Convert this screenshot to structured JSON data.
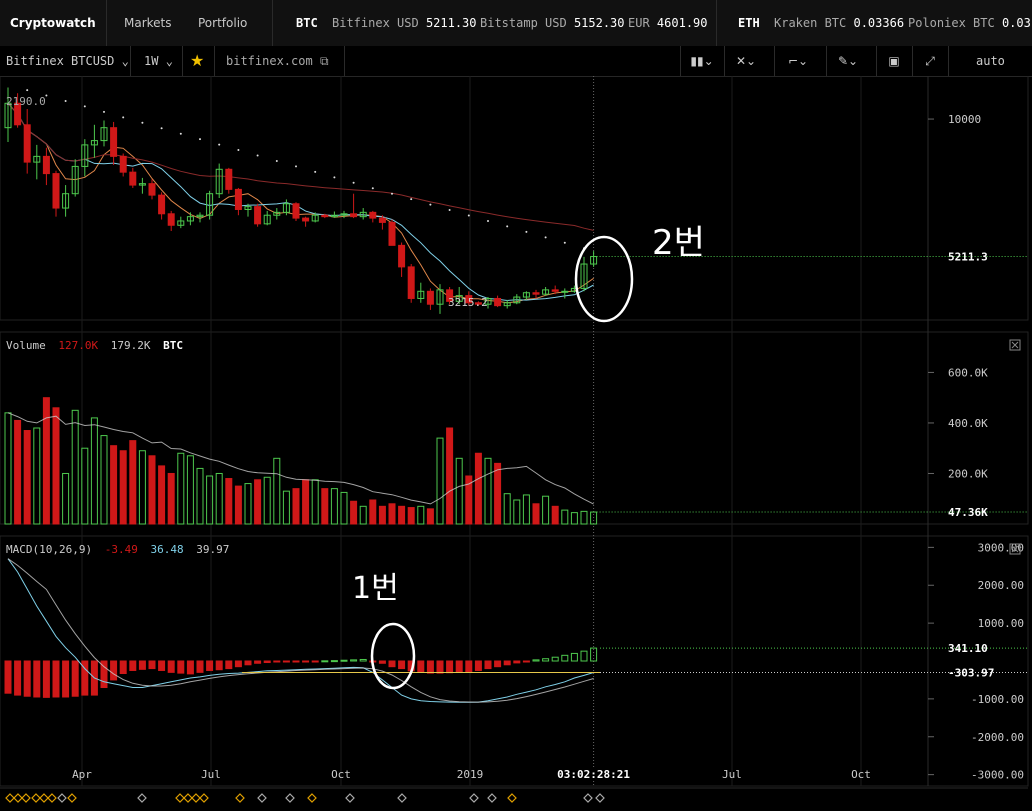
{
  "app": {
    "brand": "Cryptowatch",
    "nav": [
      "Markets",
      "Portfolio"
    ],
    "tickers": [
      {
        "name": "BTC",
        "items": [
          {
            "label": "Bitfinex USD",
            "value": "5211.30"
          },
          {
            "label": "Bitstamp USD",
            "value": "5152.30"
          },
          {
            "label": "EUR",
            "value": "4601.90"
          }
        ]
      },
      {
        "name": "ETH",
        "items": [
          {
            "label": "Kraken BTC",
            "value": "0.03366"
          },
          {
            "label": "Poloniex BTC",
            "value": "0.03..."
          }
        ]
      }
    ]
  },
  "toolbar": {
    "market": "Bitfinex BTCUSD",
    "period": "1W",
    "site": "bitfinex.com",
    "auto": "auto",
    "icons": [
      "chart-type-icon",
      "draw-line-icon",
      "indicator-icon",
      "pencil-icon",
      "panel-icon",
      "fullscreen-icon"
    ]
  },
  "chart_data": [
    {
      "type": "candlestick",
      "title": "Bitfinex BTCUSD 1W",
      "ylim": [
        3000,
        11500
      ],
      "yticks": [
        {
          "value": 10000,
          "label": "10000"
        }
      ],
      "last_price": {
        "value": 5211.3,
        "label": "5211.3"
      },
      "annotations": [
        {
          "text": "2190.0",
          "kind": "top-left label"
        },
        {
          "text": "3215.2",
          "kind": "low marker"
        }
      ],
      "candles": [
        [
          9700,
          11100,
          9200,
          10550
        ],
        [
          10550,
          10900,
          9700,
          9800
        ],
        [
          9800,
          10350,
          8100,
          8500
        ],
        [
          8500,
          9100,
          7900,
          8700
        ],
        [
          8700,
          9000,
          7700,
          8100
        ],
        [
          8100,
          8200,
          6600,
          6900
        ],
        [
          6900,
          7700,
          6600,
          7400
        ],
        [
          7400,
          8600,
          7300,
          8350
        ],
        [
          8350,
          9300,
          8000,
          9100
        ],
        [
          9100,
          9800,
          8650,
          9250
        ],
        [
          9250,
          9950,
          9050,
          9700
        ],
        [
          9700,
          9900,
          8400,
          8700
        ],
        [
          8700,
          8800,
          8000,
          8150
        ],
        [
          8150,
          8300,
          7600,
          7700
        ],
        [
          7700,
          7950,
          7400,
          7750
        ],
        [
          7750,
          7900,
          7200,
          7350
        ],
        [
          7350,
          7450,
          6500,
          6700
        ],
        [
          6700,
          6800,
          6100,
          6300
        ],
        [
          6300,
          6600,
          6200,
          6450
        ],
        [
          6450,
          6750,
          6300,
          6600
        ],
        [
          6600,
          6750,
          6400,
          6650
        ],
        [
          6650,
          7500,
          6500,
          7400
        ],
        [
          7400,
          8450,
          7250,
          8250
        ],
        [
          8250,
          8300,
          7400,
          7550
        ],
        [
          7550,
          7600,
          6650,
          6850
        ],
        [
          6850,
          7050,
          6600,
          6950
        ],
        [
          6950,
          7050,
          6250,
          6350
        ],
        [
          6350,
          6800,
          6300,
          6650
        ],
        [
          6650,
          6900,
          6500,
          6750
        ],
        [
          6750,
          7200,
          6650,
          7050
        ],
        [
          7050,
          7100,
          6450,
          6550
        ],
        [
          6550,
          6600,
          6250,
          6450
        ],
        [
          6450,
          6750,
          6400,
          6650
        ],
        [
          6650,
          6700,
          6550,
          6600
        ],
        [
          6600,
          6780,
          6560,
          6650
        ],
        [
          6650,
          6800,
          6550,
          6700
        ],
        [
          6700,
          7400,
          6550,
          6600
        ],
        [
          6600,
          6900,
          6500,
          6750
        ],
        [
          6750,
          6800,
          6400,
          6550
        ],
        [
          6550,
          6650,
          6150,
          6400
        ],
        [
          6400,
          6500,
          5900,
          5600
        ],
        [
          5600,
          5700,
          4500,
          4850
        ],
        [
          4850,
          4950,
          3600,
          3750
        ],
        [
          3750,
          4300,
          3600,
          4000
        ],
        [
          4000,
          4100,
          3350,
          3550
        ],
        [
          3550,
          4250,
          3215,
          4050
        ],
        [
          4050,
          4150,
          3550,
          3650
        ],
        [
          3650,
          4150,
          3550,
          3850
        ],
        [
          3850,
          4000,
          3500,
          3600
        ],
        [
          3600,
          3650,
          3500,
          3550
        ],
        [
          3550,
          3800,
          3400,
          3750
        ],
        [
          3750,
          3850,
          3450,
          3500
        ],
        [
          3500,
          3700,
          3400,
          3600
        ],
        [
          3600,
          3900,
          3550,
          3800
        ],
        [
          3800,
          4000,
          3700,
          3950
        ],
        [
          3950,
          4050,
          3750,
          3900
        ],
        [
          3900,
          4150,
          3850,
          4050
        ],
        [
          4050,
          4200,
          3900,
          4000
        ],
        [
          4000,
          4100,
          3750,
          4000
        ],
        [
          4000,
          4200,
          3950,
          4100
        ],
        [
          4100,
          5200,
          4000,
          4950
        ],
        [
          4950,
          5400,
          4850,
          5211
        ]
      ]
    },
    {
      "type": "bar",
      "title": "Volume",
      "legend": [
        {
          "name": "127.0K",
          "color": "#d01818"
        },
        {
          "name": "179.2K",
          "color": "#cccccc"
        },
        {
          "name": "BTC",
          "color": "#ffffff"
        }
      ],
      "ylim": [
        0,
        760000
      ],
      "yticks": [
        {
          "value": 600000,
          "label": "600.0K"
        },
        {
          "value": 400000,
          "label": "400.0K"
        },
        {
          "value": 200000,
          "label": "200.0K"
        }
      ],
      "last_value": {
        "value": 47360,
        "label": "47.36K"
      },
      "values": [
        440000,
        410000,
        370000,
        380000,
        500000,
        460000,
        200000,
        450000,
        300000,
        420000,
        350000,
        310000,
        290000,
        330000,
        290000,
        270000,
        230000,
        200000,
        280000,
        270000,
        220000,
        190000,
        200000,
        180000,
        150000,
        160000,
        175000,
        185000,
        260000,
        130000,
        140000,
        175000,
        175000,
        140000,
        140000,
        125000,
        90000,
        70000,
        95000,
        70000,
        80000,
        70000,
        65000,
        70000,
        60000,
        340000,
        380000,
        260000,
        190000,
        280000,
        260000,
        240000,
        120000,
        95000,
        115000,
        80000,
        110000,
        70000,
        55000,
        45000,
        50000,
        47360
      ]
    },
    {
      "type": "bar",
      "title": "MACD(10,26,9)",
      "legend": [
        {
          "name": "-3.49",
          "color": "#d01818"
        },
        {
          "name": "36.48",
          "color": "#7fd0e8"
        },
        {
          "name": "39.97",
          "color": "#cccccc"
        }
      ],
      "ylim": [
        -3300,
        3300
      ],
      "yticks": [
        {
          "value": 3000,
          "label": "3000.00"
        },
        {
          "value": 2000,
          "label": "2000.00"
        },
        {
          "value": 1000,
          "label": "1000.00"
        },
        {
          "value": -1000,
          "label": "-1000.00"
        },
        {
          "value": -2000,
          "label": "-2000.00"
        },
        {
          "value": -3000,
          "label": "-3000.00"
        }
      ],
      "markers": [
        {
          "value": 341.1,
          "label": "341.10"
        },
        {
          "value": -303.97,
          "label": "-303.97"
        }
      ],
      "histogram": [
        -850,
        -900,
        -930,
        -950,
        -960,
        -950,
        -950,
        -930,
        -900,
        -900,
        -700,
        -500,
        -330,
        -250,
        -220,
        -200,
        -250,
        -300,
        -320,
        -340,
        -300,
        -250,
        -230,
        -200,
        -150,
        -100,
        -60,
        -40,
        -20,
        -20,
        -10,
        -5,
        -2,
        5,
        10,
        20,
        30,
        40,
        -10,
        -60,
        -150,
        -200,
        -260,
        -300,
        -320,
        -320,
        -310,
        -300,
        -280,
        -250,
        -200,
        -150,
        -100,
        -50,
        -10,
        30,
        60,
        100,
        150,
        200,
        260,
        341
      ],
      "macd_line": [
        2700,
        2350,
        1900,
        1450,
        1050,
        650,
        350,
        100,
        -200,
        -450,
        -550,
        -600,
        -650,
        -700,
        -700,
        -650,
        -600,
        -550,
        -500,
        -450,
        -420,
        -380,
        -350,
        -330,
        -320,
        -300,
        -280,
        -260,
        -250,
        -240,
        -230,
        -220,
        -210,
        -200,
        -190,
        -180,
        -170,
        -180,
        -300,
        -500,
        -700,
        -900,
        -1000,
        -1050,
        -1070,
        -1080,
        -1085,
        -1090,
        -1090,
        -1085,
        -1050,
        -1000,
        -950,
        -880,
        -820,
        -760,
        -680,
        -620,
        -550,
        -450,
        -380,
        -304
      ]
    }
  ],
  "x_axis": {
    "labels": [
      "Apr",
      "Jul",
      "Oct",
      "2019",
      "Jul",
      "Oct"
    ],
    "cursor": "03:02:28:21"
  },
  "handwritten": {
    "first": "1번",
    "second": "2번"
  }
}
